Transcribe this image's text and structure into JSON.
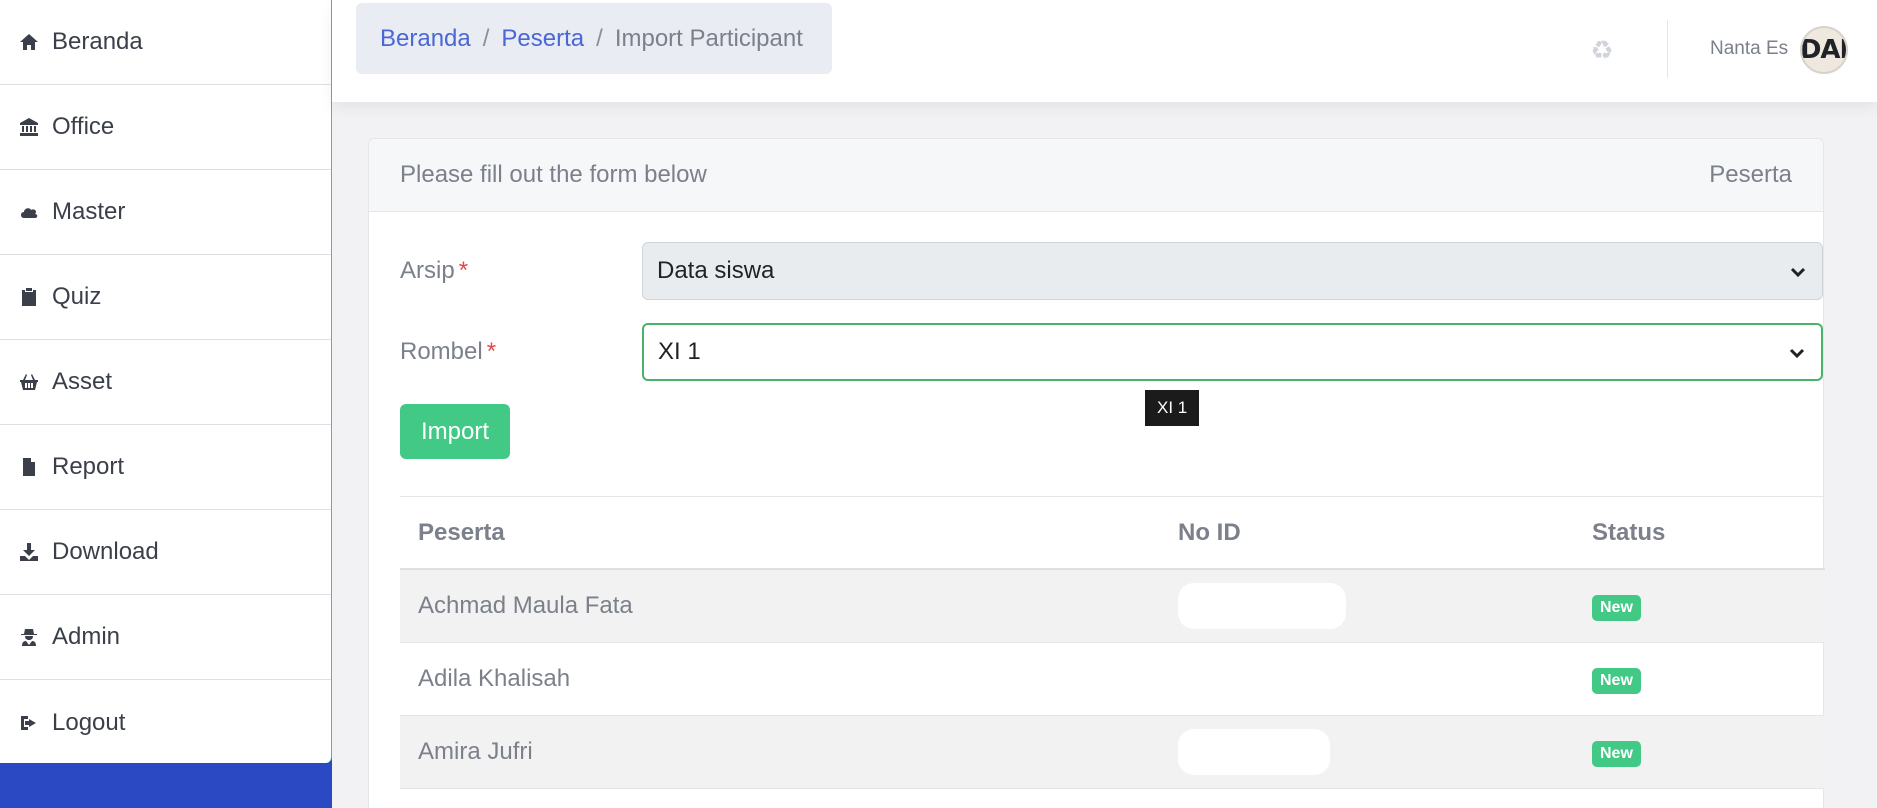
{
  "sidebar": {
    "items": [
      {
        "label": "Beranda",
        "icon": "home-icon"
      },
      {
        "label": "Office",
        "icon": "bank-icon"
      },
      {
        "label": "Master",
        "icon": "cloud-icon"
      },
      {
        "label": "Quiz",
        "icon": "clipboard-icon"
      },
      {
        "label": "Asset",
        "icon": "basket-icon"
      },
      {
        "label": "Report",
        "icon": "file-icon"
      },
      {
        "label": "Download",
        "icon": "download-icon"
      },
      {
        "label": "Admin",
        "icon": "user-secret-icon"
      },
      {
        "label": "Logout",
        "icon": "sign-out-icon"
      }
    ]
  },
  "header": {
    "breadcrumb": [
      "Beranda",
      "Peserta",
      "Import Participant"
    ],
    "breadcrumb_sep": "/",
    "user_name": "Nanta Es",
    "avatar_text": "DAI"
  },
  "card": {
    "header_left": "Please fill out the form below",
    "header_right": "Peserta"
  },
  "form": {
    "arsip": {
      "label": "Arsip",
      "required_mark": "*",
      "value": "Data siswa"
    },
    "rombel": {
      "label": "Rombel",
      "required_mark": "*",
      "value": "XI 1"
    },
    "tooltip": "XI 1",
    "import_label": "Import"
  },
  "table": {
    "headers": [
      "Peserta",
      "No ID",
      "Status"
    ],
    "rows": [
      {
        "peserta": "Achmad Maula Fata",
        "no_id": "",
        "status": "New"
      },
      {
        "peserta": "Adila Khalisah",
        "no_id": "",
        "status": "New"
      },
      {
        "peserta": "Amira Jufri",
        "no_id": "",
        "status": "New"
      }
    ]
  },
  "colors": {
    "accent_blue": "#2c49c4",
    "success_green": "#42c986",
    "link_blue": "#4a67d6"
  }
}
